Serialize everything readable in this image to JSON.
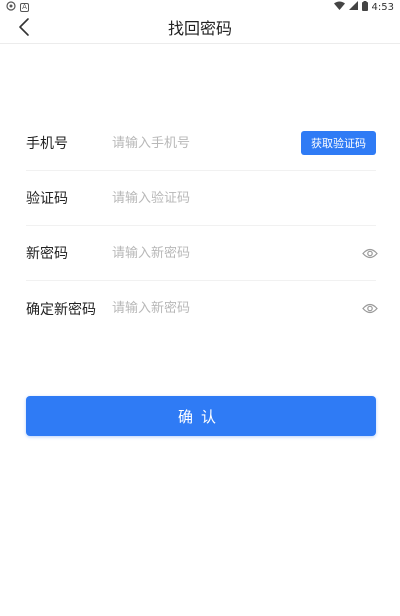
{
  "status_bar": {
    "time": "4:53",
    "left_icons": [
      "notification-icon",
      "app-icon"
    ],
    "right_icons": [
      "wifi-icon",
      "signal-icon",
      "battery-icon"
    ]
  },
  "header": {
    "title": "找回密码",
    "back_icon": "chevron-left-icon"
  },
  "form": {
    "phone": {
      "label": "手机号",
      "placeholder": "请输入手机号",
      "value": ""
    },
    "get_code_button": "获取验证码",
    "code": {
      "label": "验证码",
      "placeholder": "请输入验证码",
      "value": ""
    },
    "new_password": {
      "label": "新密码",
      "placeholder": "请输入新密码",
      "value": ""
    },
    "confirm_password": {
      "label": "确定新密码",
      "placeholder": "请输入新密码",
      "value": ""
    }
  },
  "confirm_button": "确认",
  "colors": {
    "accent": "#2f7bf5",
    "placeholder": "#b8b8b8",
    "divider": "#f1f1f1"
  }
}
